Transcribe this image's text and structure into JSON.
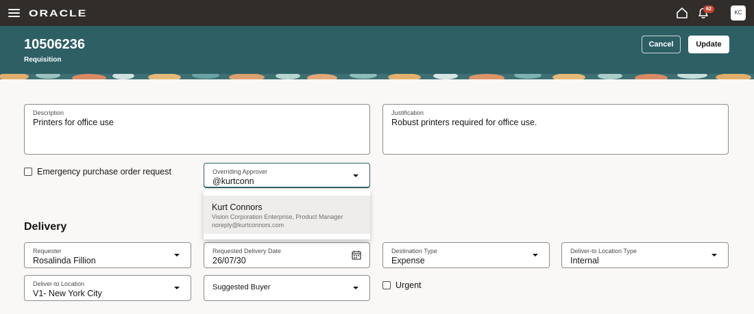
{
  "topbar": {
    "logo": "ORACLE",
    "notifications_count": "62",
    "avatar_initials": "KC"
  },
  "header": {
    "number": "10506236",
    "subtitle": "Requisition",
    "cancel_label": "Cancel",
    "update_label": "Update"
  },
  "form": {
    "description": {
      "label": "Description",
      "value": "Printers for office use"
    },
    "justification": {
      "label": "Justification",
      "value": "Robust printers required for office use."
    },
    "emergency_label": "Emergency purchase order request",
    "overriding_approver": {
      "label": "Overriding Approver",
      "value": "@kurtconn"
    },
    "approver_suggestion": {
      "name": "Kurt Connors",
      "detail": "Vision Corporation Enterprise, Product Manager",
      "email": "noreply@kurtconnors.com"
    }
  },
  "delivery": {
    "title": "Delivery",
    "requester": {
      "label": "Requester",
      "value": "Rosalinda Fillion"
    },
    "requested_date": {
      "label": "Requested Delivery Date",
      "value": "26/07/30"
    },
    "destination_type": {
      "label": "Destination Type",
      "value": "Expense"
    },
    "deliver_to_location_type": {
      "label": "Deliver-to Location Type",
      "value": "Internal"
    },
    "deliver_to_location": {
      "label": "Deliver-to Location",
      "value": "V1- New York City"
    },
    "suggested_buyer": {
      "label": "Suggested Buyer"
    },
    "urgent_label": "Urgent"
  },
  "colors": {
    "topbar": "#312d2a",
    "header": "#2d5f65",
    "badge": "#c74634",
    "background": "#f9f8f6"
  },
  "icons": [
    "hamburger-menu-icon",
    "home-icon",
    "bell-icon",
    "calendar-icon",
    "chevron-down-icon"
  ]
}
